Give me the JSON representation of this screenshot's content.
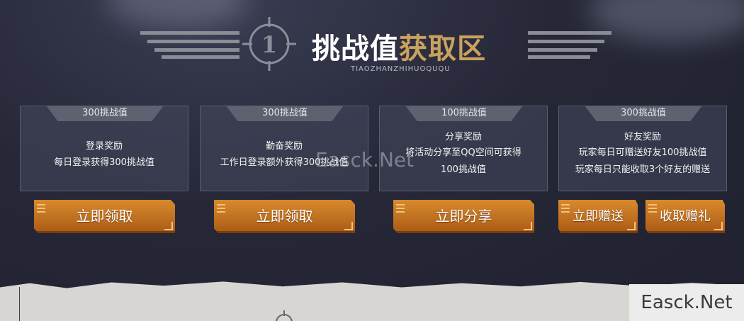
{
  "header": {
    "emblem_number": "1",
    "title_part1": "挑战值",
    "title_part2": "获取区",
    "subtitle": "TIAOZHANZHIHUOQUQU"
  },
  "cards": [
    {
      "points": "300挑战值",
      "title": "登录奖励",
      "lines": [
        "每日登录获得300挑战值"
      ]
    },
    {
      "points": "300挑战值",
      "title": "勤奋奖励",
      "lines": [
        "工作日登录额外获得300挑战值"
      ]
    },
    {
      "points": "100挑战值",
      "title": "分享奖励",
      "lines": [
        "将活动分享至QQ空间可获得",
        "100挑战值"
      ]
    },
    {
      "points": "300挑战值",
      "title": "好友奖励",
      "lines": [
        "玩家每日可赠送好友100挑战值",
        "玩家每日只能收取3个好友的赠送"
      ]
    }
  ],
  "buttons": {
    "claim1": "立即领取",
    "claim2": "立即领取",
    "share": "立即分享",
    "gift": "立即赠送",
    "receive": "收取赠礼"
  },
  "watermarks": {
    "center": "Easck.Net",
    "corner": "Easck.Net"
  },
  "colors": {
    "accent": "#c9a25d",
    "button": "#c8761f",
    "background": "#262838"
  }
}
